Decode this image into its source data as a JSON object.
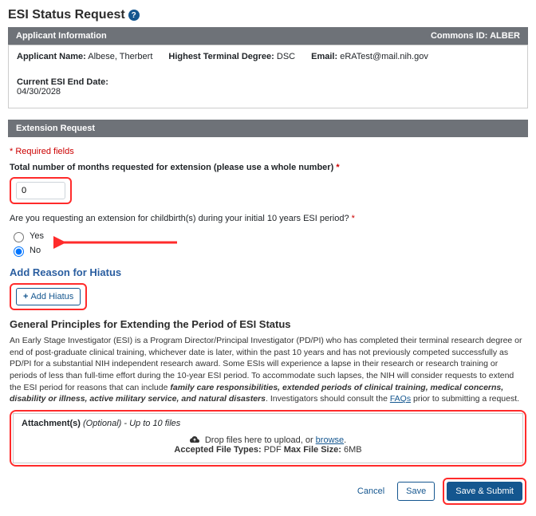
{
  "header": {
    "title": "ESI Status Request"
  },
  "applicant_section": {
    "title": "Applicant Information",
    "commons_id_label": "Commons ID:",
    "commons_id_value": "ALBER",
    "name_label": "Applicant Name:",
    "name_value": "Albese, Therbert",
    "degree_label": "Highest Terminal Degree:",
    "degree_value": "DSC",
    "email_label": "Email:",
    "email_value": "eRATest@mail.nih.gov",
    "end_date_label": "Current ESI End Date:",
    "end_date_value": "04/30/2028"
  },
  "extension_section": {
    "title": "Extension Request",
    "required_note": "* Required fields",
    "months_label": "Total number of months requested for extension (please use a whole number)",
    "months_value": "0",
    "childbirth_question": "Are you requesting an extension for childbirth(s) during your initial 10 years ESI period?",
    "radio_yes": "Yes",
    "radio_no": "No",
    "radio_selected": "no"
  },
  "hiatus_section": {
    "title": "Add Reason for Hiatus",
    "add_button": "Add Hiatus"
  },
  "principles": {
    "title": "General Principles for Extending the Period of ESI Status",
    "body_1": "An Early Stage Investigator (ESI) is a Program Director/Principal Investigator (PD/PI) who has completed their terminal research degree or end of post-graduate clinical training, whichever date is later, within the past 10 years and has not previously competed successfully as PD/PI for a substantial NIH independent research award. Some ESIs will experience a lapse in their research or research training or periods of less than full-time effort during the 10-year ESI period. To accommodate such lapses, the NIH will consider requests to extend the ESI period for reasons that can include ",
    "body_bold": "family care responsibilities, extended periods of clinical training, medical concerns, disability or illness, active military service, and natural disasters",
    "body_2": ". Investigators should consult the ",
    "faqs_link": "FAQs",
    "body_3": " prior to submitting a request."
  },
  "attachments": {
    "label": "Attachment(s)",
    "optional": "(Optional)",
    "limit": "- Up to 10 files",
    "drop_text": "Drop files here to upload, or ",
    "browse": "browse",
    "period": ".",
    "accepted_label": "Accepted File Types:",
    "accepted_value": "PDF",
    "maxsize_label": "Max File Size:",
    "maxsize_value": "6MB"
  },
  "buttons": {
    "cancel": "Cancel",
    "save": "Save",
    "save_submit": "Save & Submit"
  }
}
